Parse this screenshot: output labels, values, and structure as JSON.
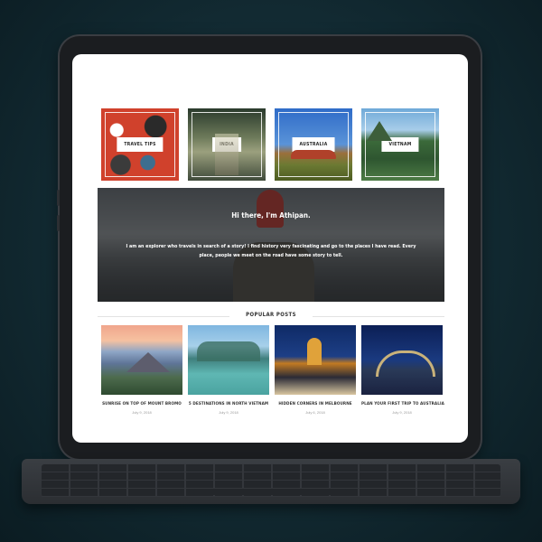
{
  "categories": [
    {
      "label": "TRAVEL TIPS"
    },
    {
      "label": "INDIA"
    },
    {
      "label": "AUSTRALIA"
    },
    {
      "label": "VIETNAM"
    }
  ],
  "hero": {
    "greeting": "Hi there, I'm Athipan.",
    "bio": "I am an explorer who travels in search of a story! I find history very fascinating and go to the places I have read. Every place, people we meet on the road have some story to tell."
  },
  "popular_posts": {
    "heading": "POPULAR POSTS",
    "items": [
      {
        "title": "SUNRISE ON TOP OF MOUNT BROMO",
        "date": "July 9, 2018"
      },
      {
        "title": "5 DESTINATIONS IN NORTH VIETNAM",
        "date": "July 9, 2018"
      },
      {
        "title": "HIDDEN CORNERS IN MELBOURNE",
        "date": "July 6, 2018"
      },
      {
        "title": "PLAN YOUR FIRST TRIP TO AUSTRALIA",
        "date": "July 9, 2018"
      }
    ]
  },
  "colors": {
    "background": "#122a32",
    "tablet_bezel": "#1b1d20",
    "keyboard": "#2b2e32"
  }
}
